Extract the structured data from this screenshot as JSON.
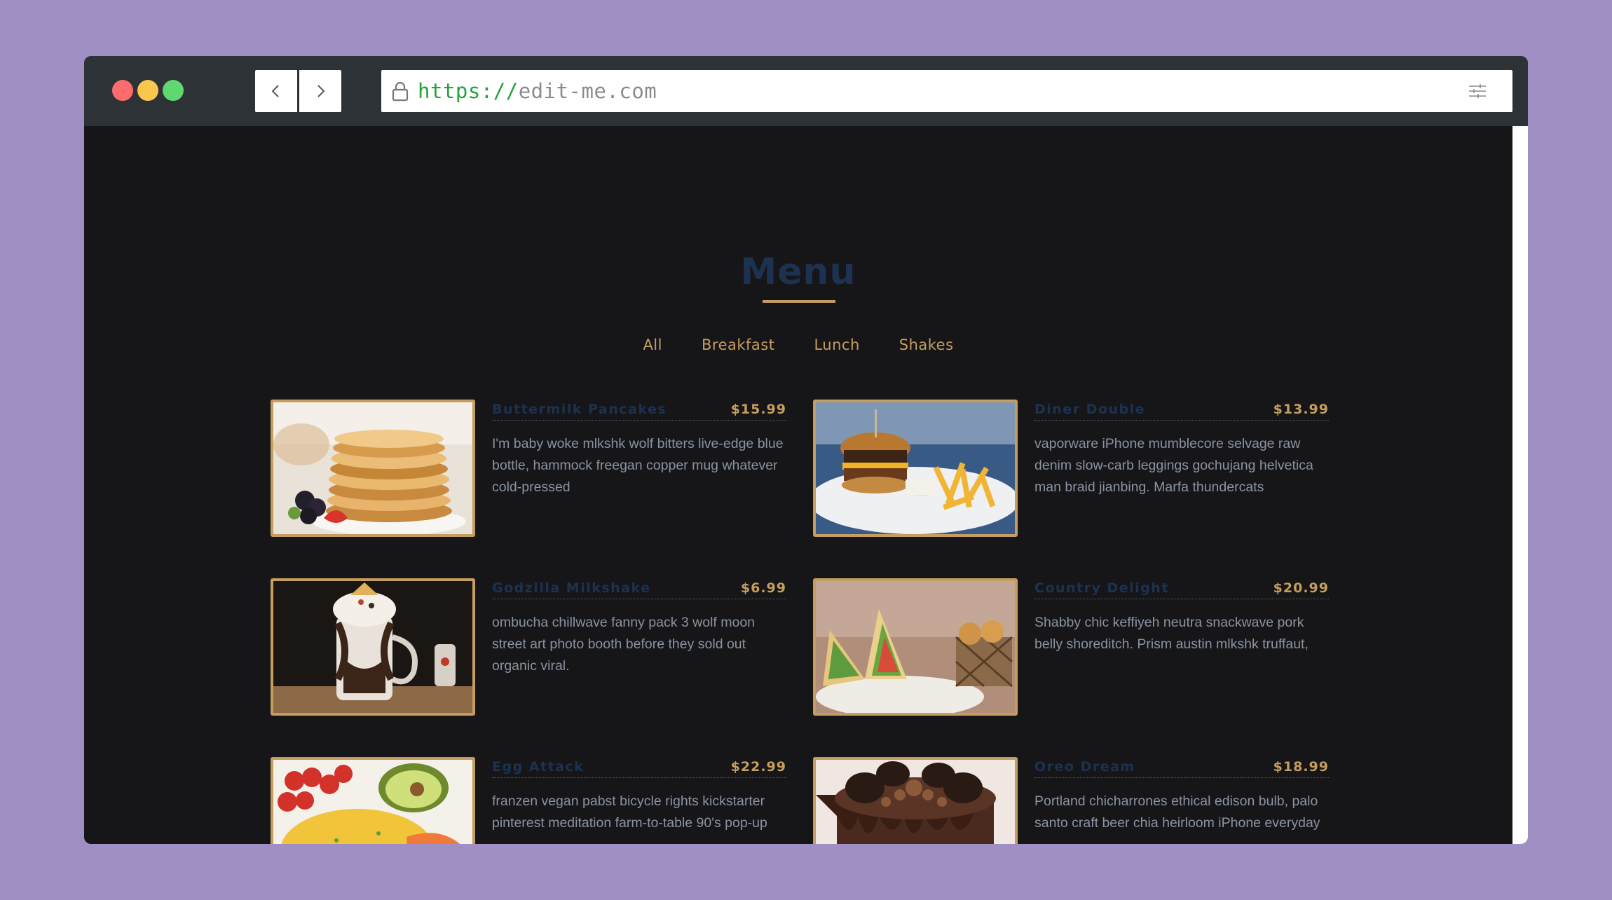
{
  "browser": {
    "url_scheme": "https://",
    "url_host": "edit-me.com"
  },
  "page": {
    "title": "Menu",
    "filters": [
      "All",
      "Breakfast",
      "Lunch",
      "Shakes"
    ]
  },
  "items": [
    {
      "name": "Buttermilk Pancakes",
      "price": "$15.99",
      "desc": "I'm baby woke mlkshk wolf bitters live-edge blue bottle, hammock freegan copper mug whatever cold-pressed",
      "image": "pancakes"
    },
    {
      "name": "Diner Double",
      "price": "$13.99",
      "desc": "vaporware iPhone mumblecore selvage raw denim slow-carb leggings gochujang helvetica man braid jianbing. Marfa thundercats",
      "image": "burger-and-fries"
    },
    {
      "name": "Godzilla Milkshake",
      "price": "$6.99",
      "desc": "ombucha chillwave fanny pack 3 wolf moon street art photo booth before they sold out organic viral.",
      "image": "milkshake"
    },
    {
      "name": "Country Delight",
      "price": "$20.99",
      "desc": "Shabby chic keffiyeh neutra snackwave pork belly shoreditch. Prism austin mlkshk truffaut,",
      "image": "sandwich"
    },
    {
      "name": "Egg Attack",
      "price": "$22.99",
      "desc": "franzen vegan pabst bicycle rights kickstarter pinterest meditation farm-to-table 90's pop-up",
      "image": "eggs-tomatoes"
    },
    {
      "name": "Oreo Dream",
      "price": "$18.99",
      "desc": "Portland chicharrones ethical edison bulb, palo santo craft beer chia heirloom iPhone everyday",
      "image": "oreo-cake"
    }
  ],
  "colors": {
    "accent": "#c59d5f",
    "title": "#1c3250",
    "page_bg": "#161618",
    "browser_chrome": "#2d3237",
    "desktop_bg": "#a08fc5"
  }
}
